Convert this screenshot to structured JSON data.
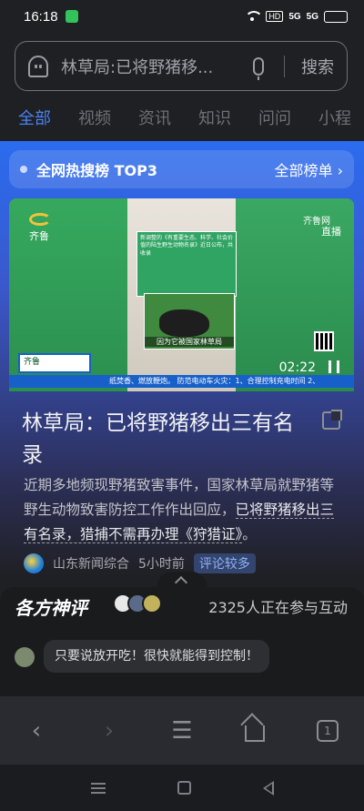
{
  "status_bar": {
    "time": "16:18",
    "hd": "HD",
    "signal_1": "5G",
    "signal_2": "5G"
  },
  "search": {
    "query": "林草局:已将野猪移...",
    "button": "搜索"
  },
  "tabs": [
    "全部",
    "视频",
    "资讯",
    "知识",
    "问问",
    "小程"
  ],
  "hot": {
    "title": "全网热搜榜 TOP3",
    "more": "全部榜单 ›"
  },
  "video": {
    "channel_logo": "齐鲁",
    "live_logo": "齐鲁网",
    "live": "直播",
    "card_text": "新调整的《有重要生态、科学、社会价值的陆生野生动物名录》近日公布，共收录",
    "caption": "因为它被国家林草局",
    "ticker": "纸焚香、燃放鞭炮。  防范电动车火灾：1、合理控制充电时间 2、",
    "duration": "02:22"
  },
  "article": {
    "headline": "林草局：已将野猪移出三有名录",
    "summary_1": "近期多地频现野猪致害事件，国家林草局就野猪等野生动物致害防控工作作出回应，",
    "summary_link": "已将野猪移出三有名录，猎捕不需再办理《狩猎证》",
    "summary_end": "。",
    "source": "山东新闻综合",
    "time_ago": "5小时前",
    "badge": "评论较多"
  },
  "comments": {
    "title": "各方神评",
    "count": "2325人正在参与互动",
    "first": "只要说放开吃！很快就能得到控制！"
  },
  "toolbar": {
    "tab_count": "1"
  }
}
